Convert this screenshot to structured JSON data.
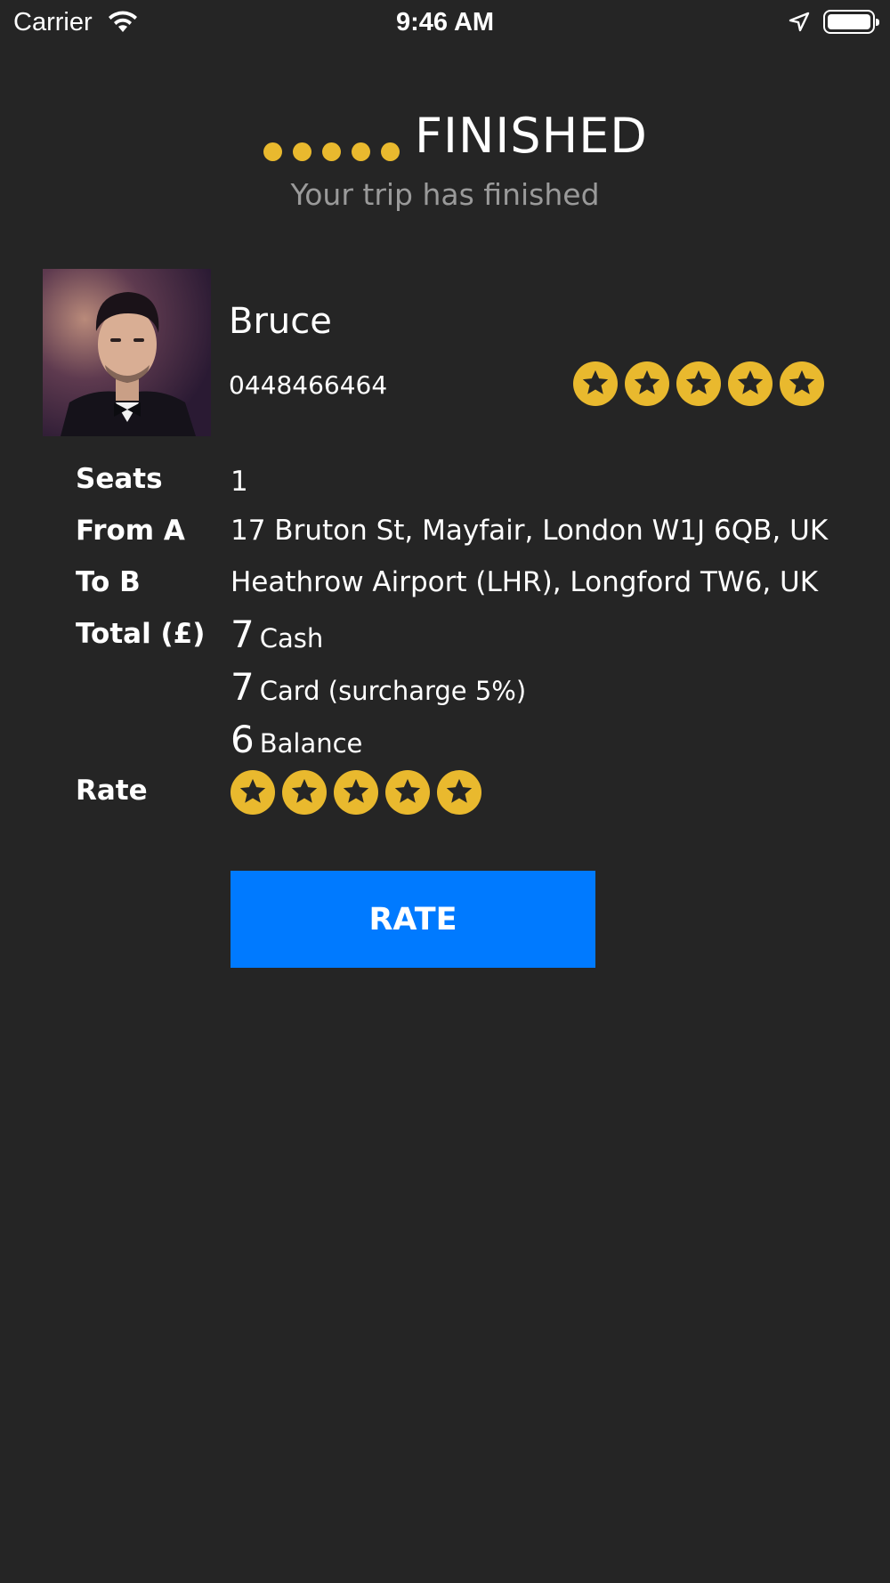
{
  "status_bar": {
    "carrier": "Carrier",
    "time": "9:46 AM",
    "icons": [
      "wifi-icon",
      "location-arrow-icon",
      "battery-icon"
    ]
  },
  "header": {
    "status_title": "FINISHED",
    "status_subtitle": "Your trip has finished",
    "progress_dots": 5,
    "accent_color": "#e9b92e"
  },
  "driver": {
    "name": "Bruce",
    "phone": "0448466464",
    "rating": 5,
    "photo": "driver-photo"
  },
  "details": {
    "seats_label": "Seats",
    "seats_value": "1",
    "from_label": "From A",
    "from_value": "17 Bruton St, Mayfair, London W1J 6QB, UK",
    "to_label": "To B",
    "to_value": "Heathrow Airport (LHR), Longford TW6, UK",
    "total_label": "Total (£)",
    "totals": [
      {
        "amount": "7",
        "method": "Cash"
      },
      {
        "amount": "7",
        "method": "Card (surcharge 5%)"
      },
      {
        "amount": "6",
        "method": "Balance"
      }
    ],
    "rate_label": "Rate",
    "rate_value": 5
  },
  "action": {
    "rate_button_label": "RATE",
    "button_color": "#007aff"
  },
  "colors": {
    "background": "#252525",
    "star": "#e9b92e",
    "star_glyph": "#252525"
  }
}
